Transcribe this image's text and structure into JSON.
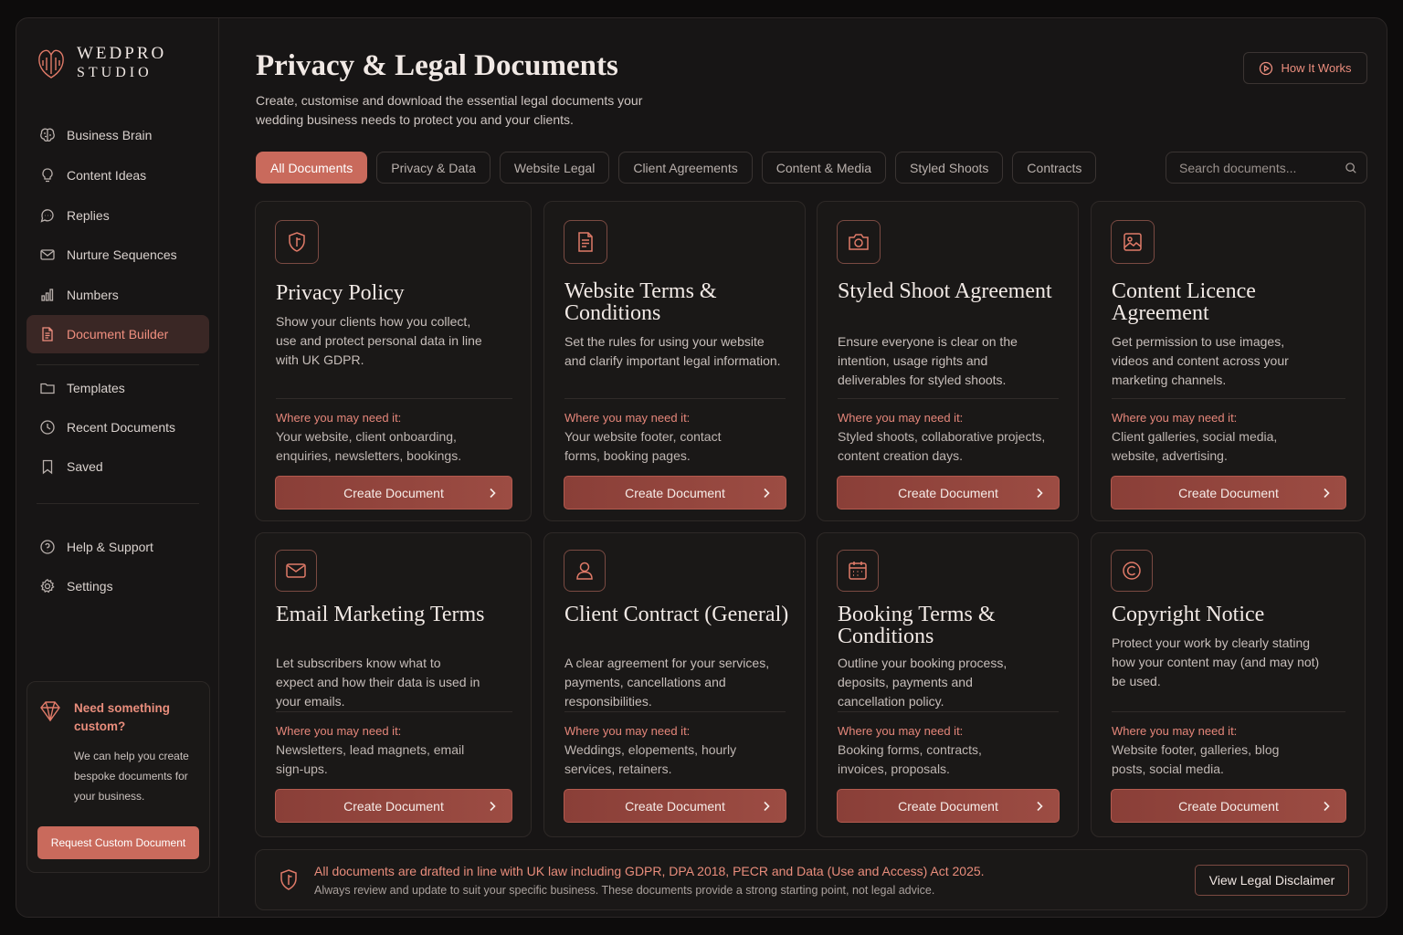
{
  "brand": {
    "line1": "WEDPRO",
    "line2": "STUDIO"
  },
  "sidebar": {
    "items": [
      {
        "label": "Business Brain",
        "icon": "brain-icon"
      },
      {
        "label": "Content Ideas",
        "icon": "lightbulb-icon"
      },
      {
        "label": "Replies",
        "icon": "chat-icon"
      },
      {
        "label": "Nurture Sequences",
        "icon": "mail-icon"
      },
      {
        "label": "Numbers",
        "icon": "bar-chart-icon"
      },
      {
        "label": "Document Builder",
        "icon": "document-icon",
        "active": true
      },
      {
        "label": "Templates",
        "icon": "folder-icon"
      },
      {
        "label": "Recent Documents",
        "icon": "clock-icon"
      },
      {
        "label": "Saved",
        "icon": "bookmark-icon"
      },
      {
        "label": "Help & Support",
        "icon": "help-icon"
      },
      {
        "label": "Settings",
        "icon": "gear-icon"
      }
    ],
    "custom": {
      "title": "Need something custom?",
      "text": "We can help you create bespoke documents for your business.",
      "button": "Request Custom Document"
    }
  },
  "header": {
    "title": "Privacy & Legal Documents",
    "subtitle": "Create, customise and download the essential legal documents your wedding business needs to protect you and your clients.",
    "how_button": "How It Works"
  },
  "tabs": [
    "All Documents",
    "Privacy & Data",
    "Website Legal",
    "Client Agreements",
    "Content & Media",
    "Styled Shoots",
    "Contracts"
  ],
  "active_tab": "All Documents",
  "search": {
    "placeholder": "Search documents..."
  },
  "cards": [
    {
      "title": "Privacy Policy",
      "icon": "shield-icon",
      "desc": "Show your clients how you collect, use and protect personal data in line with UK GDPR.",
      "need_label": "Where you may need it:",
      "need": "Your website, client onboarding, enquiries, newsletters, bookings.",
      "button": "Create Document"
    },
    {
      "title": "Website Terms & Conditions",
      "icon": "document-icon",
      "desc": "Set the rules for using your website and clarify important legal information.",
      "need_label": "Where you may need it:",
      "need": "Your website footer, contact forms, booking pages.",
      "button": "Create Document"
    },
    {
      "title": "Styled Shoot Agreement",
      "icon": "camera-icon",
      "desc": "Ensure everyone is clear on the intention, usage rights and deliverables for styled shoots.",
      "need_label": "Where you may need it:",
      "need": "Styled shoots, collaborative projects, content creation days.",
      "button": "Create Document"
    },
    {
      "title": "Content Licence Agreement",
      "icon": "image-icon",
      "desc": "Get permission to use images, videos and content across your marketing channels.",
      "need_label": "Where you may need it:",
      "need": "Client galleries, social media, website, advertising.",
      "button": "Create Document"
    },
    {
      "title": "Email Marketing Terms",
      "icon": "mail-icon",
      "desc": "Let subscribers know what to expect and how their data is used in your emails.",
      "need_label": "Where you may need it:",
      "need": "Newsletters, lead magnets, email sign-ups.",
      "button": "Create Document"
    },
    {
      "title": "Client Contract (General)",
      "icon": "user-icon",
      "desc": "A clear agreement for your services, payments, cancellations and responsibilities.",
      "need_label": "Where you may need it:",
      "need": "Weddings, elopements, hourly services, retainers.",
      "button": "Create Document"
    },
    {
      "title": "Booking Terms & Conditions",
      "icon": "calendar-icon",
      "desc": "Outline your booking process, deposits, payments and cancellation policy.",
      "need_label": "Where you may need it:",
      "need": "Booking forms, contracts, invoices, proposals.",
      "button": "Create Document"
    },
    {
      "title": "Copyright Notice",
      "icon": "copyright-icon",
      "desc": "Protect your work by clearly stating how your content may (and may not) be used.",
      "need_label": "Where you may need it:",
      "need": "Website footer, galleries, blog posts, social media.",
      "button": "Create Document"
    }
  ],
  "notice": {
    "main": "All documents are drafted in line with UK law including GDPR, DPA 2018, PECR and Data (Use and Access) Act 2025.",
    "sub": "Always review and update to suit your specific business. These documents provide a strong starting point, not legal advice.",
    "button": "View Legal Disclaimer"
  },
  "colors": {
    "accent": "#c96a5c",
    "accent_text": "#e98d7c",
    "background": "#171515"
  }
}
